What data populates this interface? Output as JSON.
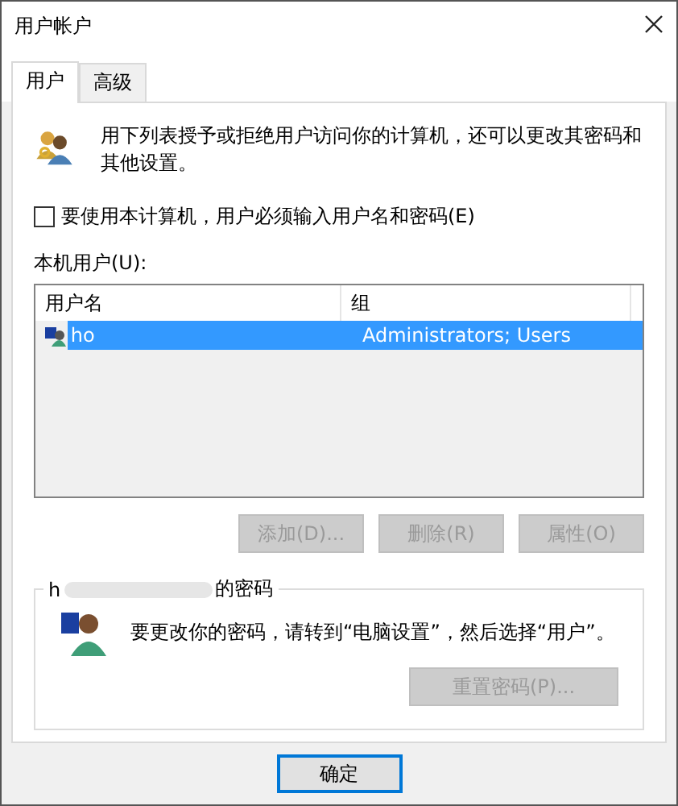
{
  "window": {
    "title": "用户帐户"
  },
  "tabs": [
    {
      "label": "用户",
      "selected": true
    },
    {
      "label": "高级",
      "selected": false
    }
  ],
  "description": "用下列表授予或拒绝用户访问你的计算机，还可以更改其密码和其他设置。",
  "require_login": {
    "label": "要使用本计算机，用户必须输入用户名和密码(E)",
    "checked": false
  },
  "users": {
    "label": "本机用户(U):",
    "columns": [
      "用户名",
      "组"
    ],
    "rows": [
      {
        "name": "ho",
        "group": "Administrators; Users",
        "selected": true
      }
    ]
  },
  "user_buttons": [
    {
      "label": "添加(D)...",
      "disabled": true
    },
    {
      "label": "删除(R)",
      "disabled": true
    },
    {
      "label": "属性(O)",
      "disabled": true
    }
  ],
  "password": {
    "title_start": "h",
    "title_end": "的密码",
    "message": "要更改你的密码，请转到“电脑设置”，然后选择“用户”。",
    "reset_button": {
      "label": "重置密码(P)...",
      "disabled": true
    }
  },
  "footer_buttons": [
    {
      "label": "确定",
      "default": true
    }
  ]
}
